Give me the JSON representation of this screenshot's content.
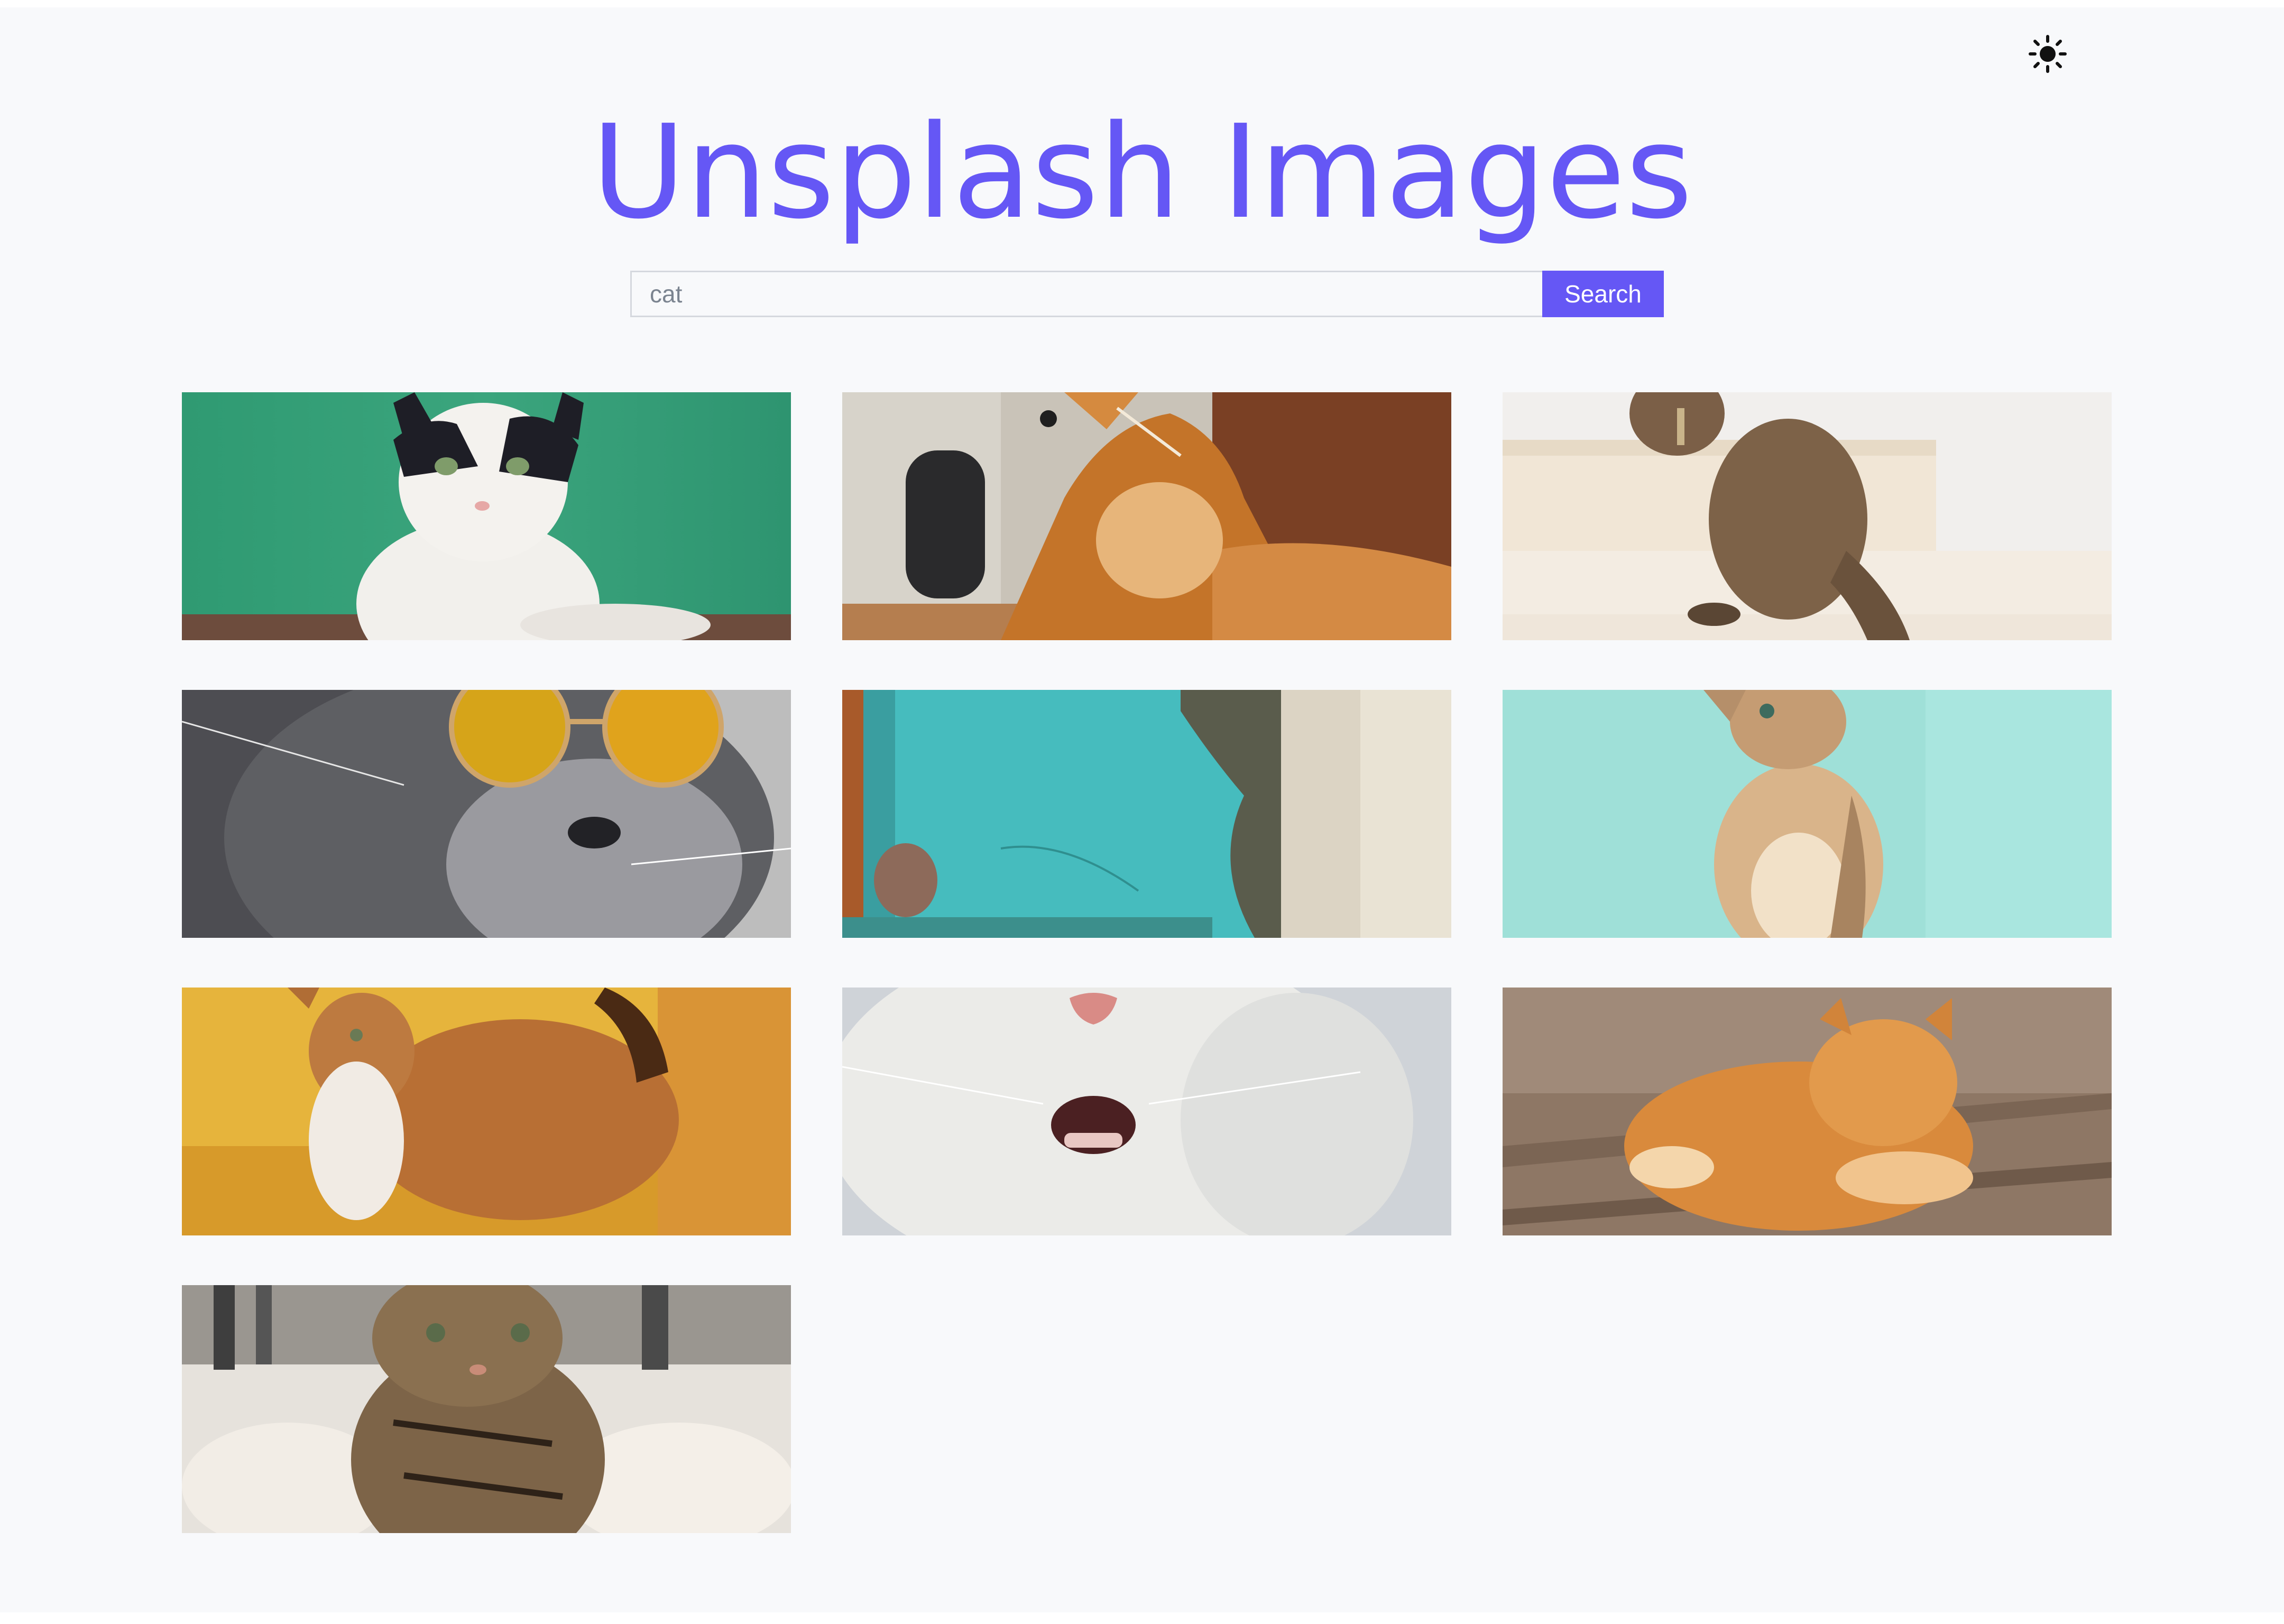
{
  "header": {
    "title": "Unsplash Images",
    "theme_icon": "sun-icon"
  },
  "search": {
    "value": "cat",
    "button_label": "Search"
  },
  "images": [
    {
      "description": "black and white cat on green background"
    },
    {
      "description": "orange long-haired cat looking up"
    },
    {
      "description": "tabby cat sitting on white stairs"
    },
    {
      "description": "gray cat wearing yellow sunglasses"
    },
    {
      "description": "cat peeking beside teal wall"
    },
    {
      "description": "tabby kitten looking up on teal background"
    },
    {
      "description": "orange and white cat on yellow background"
    },
    {
      "description": "white cat with open mouth close-up"
    },
    {
      "description": "orange tabby cat lying on wooden floor"
    },
    {
      "description": "tabby kitten close-up"
    }
  ],
  "colors": {
    "accent": "#6557f5",
    "background": "#f8f9fb"
  }
}
